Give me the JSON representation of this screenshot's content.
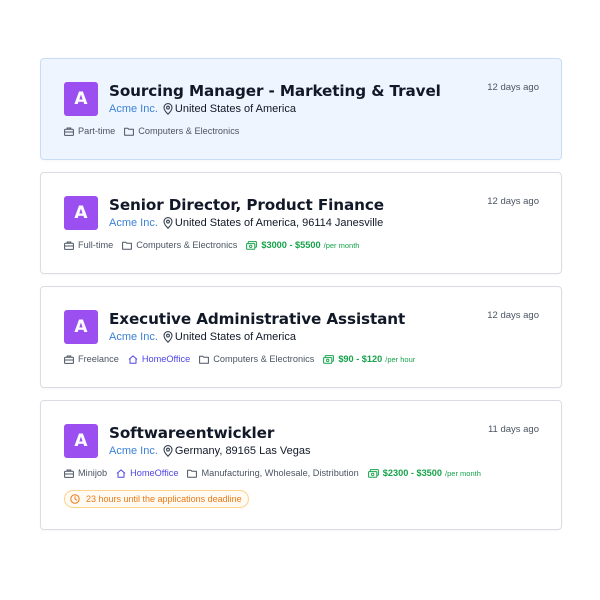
{
  "jobs": [
    {
      "logo_letter": "A",
      "title": "Sourcing Manager - Marketing & Travel",
      "company": "Acme Inc.",
      "location": "United States of America",
      "posted": "12 days ago",
      "employment_type": "Part-time",
      "category": "Computers & Electronics",
      "selected": true
    },
    {
      "logo_letter": "A",
      "title": "Senior Director, Product Finance",
      "company": "Acme Inc.",
      "location": "United States of America, 96114 Janesville",
      "posted": "12 days ago",
      "employment_type": "Full-time",
      "category": "Computers & Electronics",
      "salary": "$3000 - $5500",
      "salary_period": "/per month"
    },
    {
      "logo_letter": "A",
      "title": "Executive Administrative Assistant",
      "company": "Acme Inc.",
      "location": "United States of America",
      "posted": "12 days ago",
      "employment_type": "Freelance",
      "work_mode": "HomeOffice",
      "category": "Computers & Electronics",
      "salary": "$90 - $120",
      "salary_period": "/per hour"
    },
    {
      "logo_letter": "A",
      "title": "Softwareentwickler",
      "company": "Acme Inc.",
      "location": "Germany, 89165 Las Vegas",
      "posted": "11 days ago",
      "employment_type": "Minijob",
      "work_mode": "HomeOffice",
      "category": "Manufacturing, Wholesale, Distribution",
      "salary": "$2300 - $3500",
      "salary_period": "/per month",
      "deadline": "23 hours until the applications deadline"
    }
  ],
  "colors": {
    "logo_bg": "#9b4ff0",
    "company_link": "#3b82d6",
    "home_office": "#4f46e5",
    "salary": "#16a34a",
    "deadline": "#ea7a17",
    "selected_bg": "#eef5fe"
  },
  "icons": {
    "location": "map-pin-icon",
    "employment_type": "briefcase-icon",
    "category": "folder-icon",
    "work_mode": "home-icon",
    "salary": "banknote-icon",
    "deadline": "clock-icon"
  }
}
